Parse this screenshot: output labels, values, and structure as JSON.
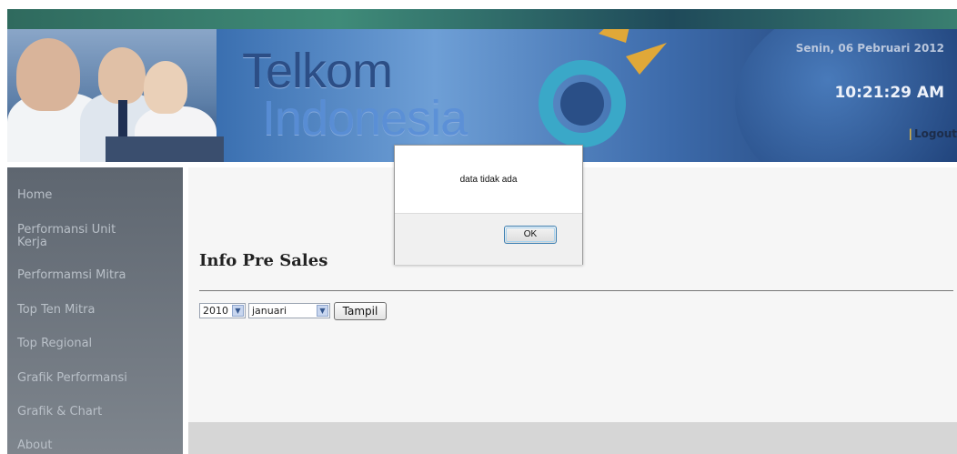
{
  "header": {
    "brand_line1": "Telkom",
    "brand_line2": "Indonesia",
    "date": "Senin, 06 Pebruari 2012",
    "time": "10:21:29 AM",
    "logout_label": "Logout"
  },
  "sidebar": {
    "items": [
      {
        "label": "Home"
      },
      {
        "label": "Performansi Unit Kerja"
      },
      {
        "label": "Performamsi Mitra"
      },
      {
        "label": "Top Ten Mitra"
      },
      {
        "label": "Top Regional"
      },
      {
        "label": "Grafik Performansi"
      },
      {
        "label": "Grafik & Chart"
      },
      {
        "label": "About"
      }
    ]
  },
  "main": {
    "title": "Info Pre Sales",
    "year_select": {
      "value": "2010"
    },
    "month_select": {
      "value": "januari"
    },
    "submit_label": "Tampil"
  },
  "dialog": {
    "message": "data tidak ada",
    "ok_label": "OK"
  },
  "colors": {
    "header_blue": "#3a6fb0",
    "sidebar_grey": "#6e757e",
    "logo_gold": "#e0a838",
    "logo_teal": "#3aa8c8"
  },
  "icons": {
    "select_arrow": "chevron-down-icon"
  }
}
